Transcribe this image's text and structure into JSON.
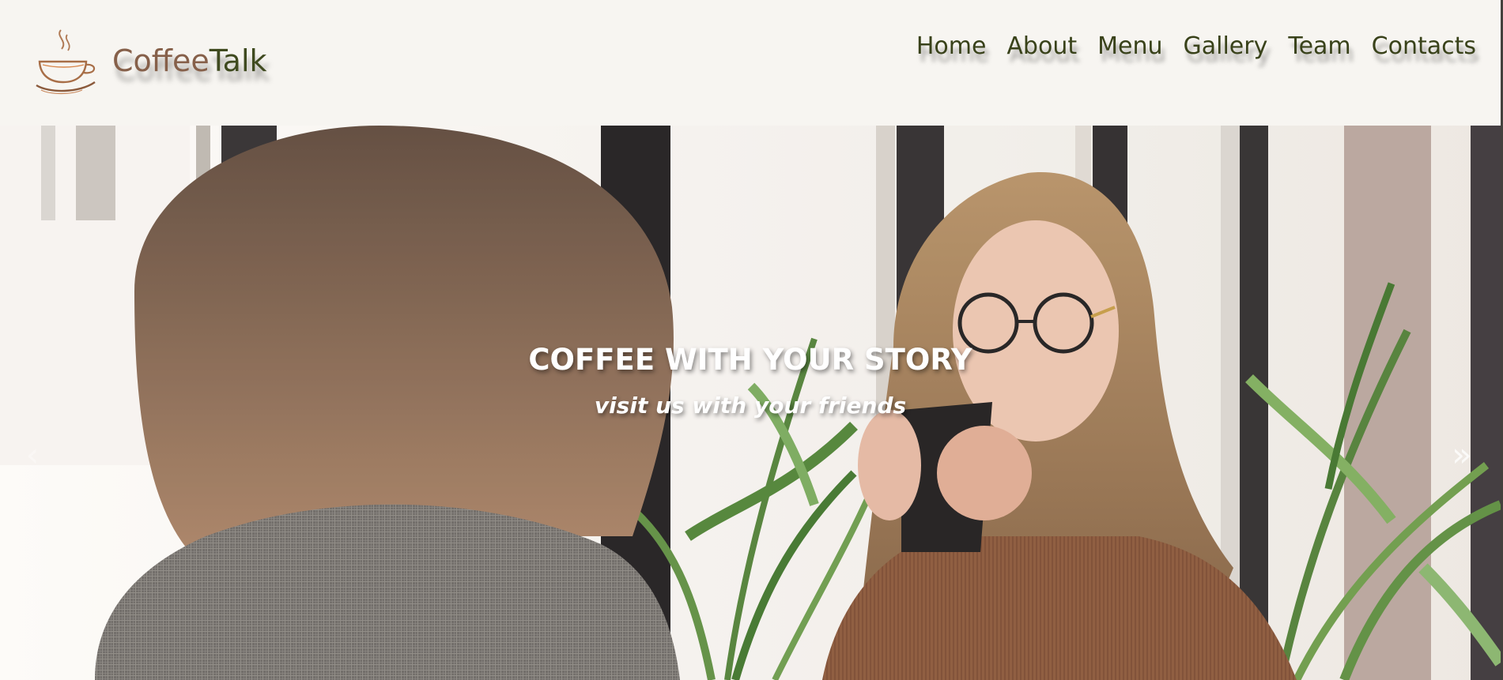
{
  "brand": {
    "name_part1": "Coffee",
    "name_part2": "Talk",
    "icon": "coffee-cup-icon"
  },
  "nav": {
    "items": [
      {
        "label": "Home"
      },
      {
        "label": "About"
      },
      {
        "label": "Menu"
      },
      {
        "label": "Gallery"
      },
      {
        "label": "Team"
      },
      {
        "label": "Contacts"
      }
    ]
  },
  "hero": {
    "title": "COFFEE WITH YOUR STORY",
    "subtitle": "visit us with your friends",
    "prev_arrow": "‹",
    "next_arrow": "»",
    "image": "two-women-talking-in-cafe"
  },
  "colors": {
    "header_bg": "#f7f5f1",
    "brand_coffee": "#86604a",
    "brand_talk": "#3f4a1f",
    "nav_text": "#39421a",
    "hero_text": "#ffffff"
  }
}
